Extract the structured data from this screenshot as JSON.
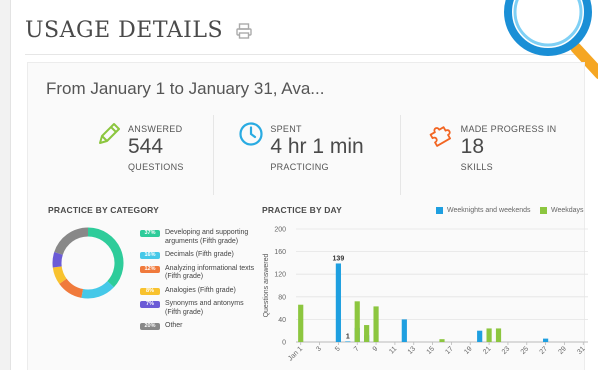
{
  "page": {
    "title": "USAGE DETAILS",
    "print_icon": "printer-icon"
  },
  "range": {
    "text": "From January 1 to January 31, Ava..."
  },
  "stats": [
    {
      "icon": "pencil-icon",
      "label": "ANSWERED",
      "value": "544",
      "sub": "QUESTIONS",
      "color": "#8cc63f"
    },
    {
      "icon": "clock-icon",
      "label": "SPENT",
      "value": "4 hr 1 min",
      "sub": "PRACTICING",
      "color": "#29abe2"
    },
    {
      "icon": "puzzle-icon",
      "label": "MADE PROGRESS IN",
      "value": "18",
      "sub": "SKILLS",
      "color": "#f26522"
    }
  ],
  "category": {
    "title": "PRACTICE BY CATEGORY",
    "items": [
      {
        "pct": "37%",
        "value": 37,
        "label": "Developing and supporting arguments (Fifth grade)",
        "color": "#2ecc9a"
      },
      {
        "pct": "16%",
        "value": 16,
        "label": "Decimals (Fifth grade)",
        "color": "#45c8e8"
      },
      {
        "pct": "12%",
        "value": 12,
        "label": "Analyzing informational texts (Fifth grade)",
        "color": "#f07a3c"
      },
      {
        "pct": "8%",
        "value": 8,
        "label": "Analogies (Fifth grade)",
        "color": "#f8c22e"
      },
      {
        "pct": "7%",
        "value": 7,
        "label": "Synonyms and antonyms (Fifth grade)",
        "color": "#6b5bd6"
      },
      {
        "pct": "20%",
        "value": 20,
        "label": "Other",
        "color": "#888888"
      }
    ]
  },
  "day": {
    "title": "PRACTICE BY DAY",
    "legend": [
      {
        "label": "Weeknights and weekends",
        "color": "#1e9fe0"
      },
      {
        "label": "Weekdays",
        "color": "#8cc63f"
      }
    ]
  },
  "chart_data": {
    "type": "bar",
    "ylabel": "Questions answered",
    "ylim": [
      0,
      200
    ],
    "yticks": [
      0,
      40,
      80,
      120,
      160,
      200
    ],
    "x_tick_labels": [
      "Jan 1",
      "3",
      "5",
      "7",
      "9",
      "11",
      "13",
      "15",
      "17",
      "19",
      "21",
      "23",
      "25",
      "27",
      "29",
      "31"
    ],
    "days": [
      1,
      2,
      3,
      4,
      5,
      6,
      7,
      8,
      9,
      10,
      11,
      12,
      13,
      14,
      15,
      16,
      17,
      18,
      19,
      20,
      21,
      22,
      23,
      24,
      25,
      26,
      27,
      28,
      29,
      30,
      31
    ],
    "series": [
      {
        "name": "Weeknights and weekends",
        "color": "#1e9fe0",
        "values": [
          0,
          0,
          0,
          0,
          139,
          1,
          25,
          12,
          0,
          0,
          0,
          40,
          0,
          0,
          0,
          0,
          0,
          0,
          0,
          20,
          0,
          0,
          0,
          0,
          0,
          0,
          6,
          0,
          0,
          0,
          0
        ]
      },
      {
        "name": "Weekdays",
        "color": "#8cc63f",
        "values": [
          66,
          0,
          0,
          0,
          0,
          0,
          72,
          30,
          63,
          0,
          0,
          0,
          0,
          0,
          0,
          5,
          0,
          0,
          0,
          0,
          24,
          24,
          0,
          0,
          0,
          0,
          0,
          0,
          0,
          0,
          0
        ]
      }
    ],
    "data_labels": [
      {
        "day": 5,
        "text": "139"
      },
      {
        "day": 6,
        "text": "1"
      }
    ],
    "grid": true,
    "legend_position": "top-right"
  }
}
